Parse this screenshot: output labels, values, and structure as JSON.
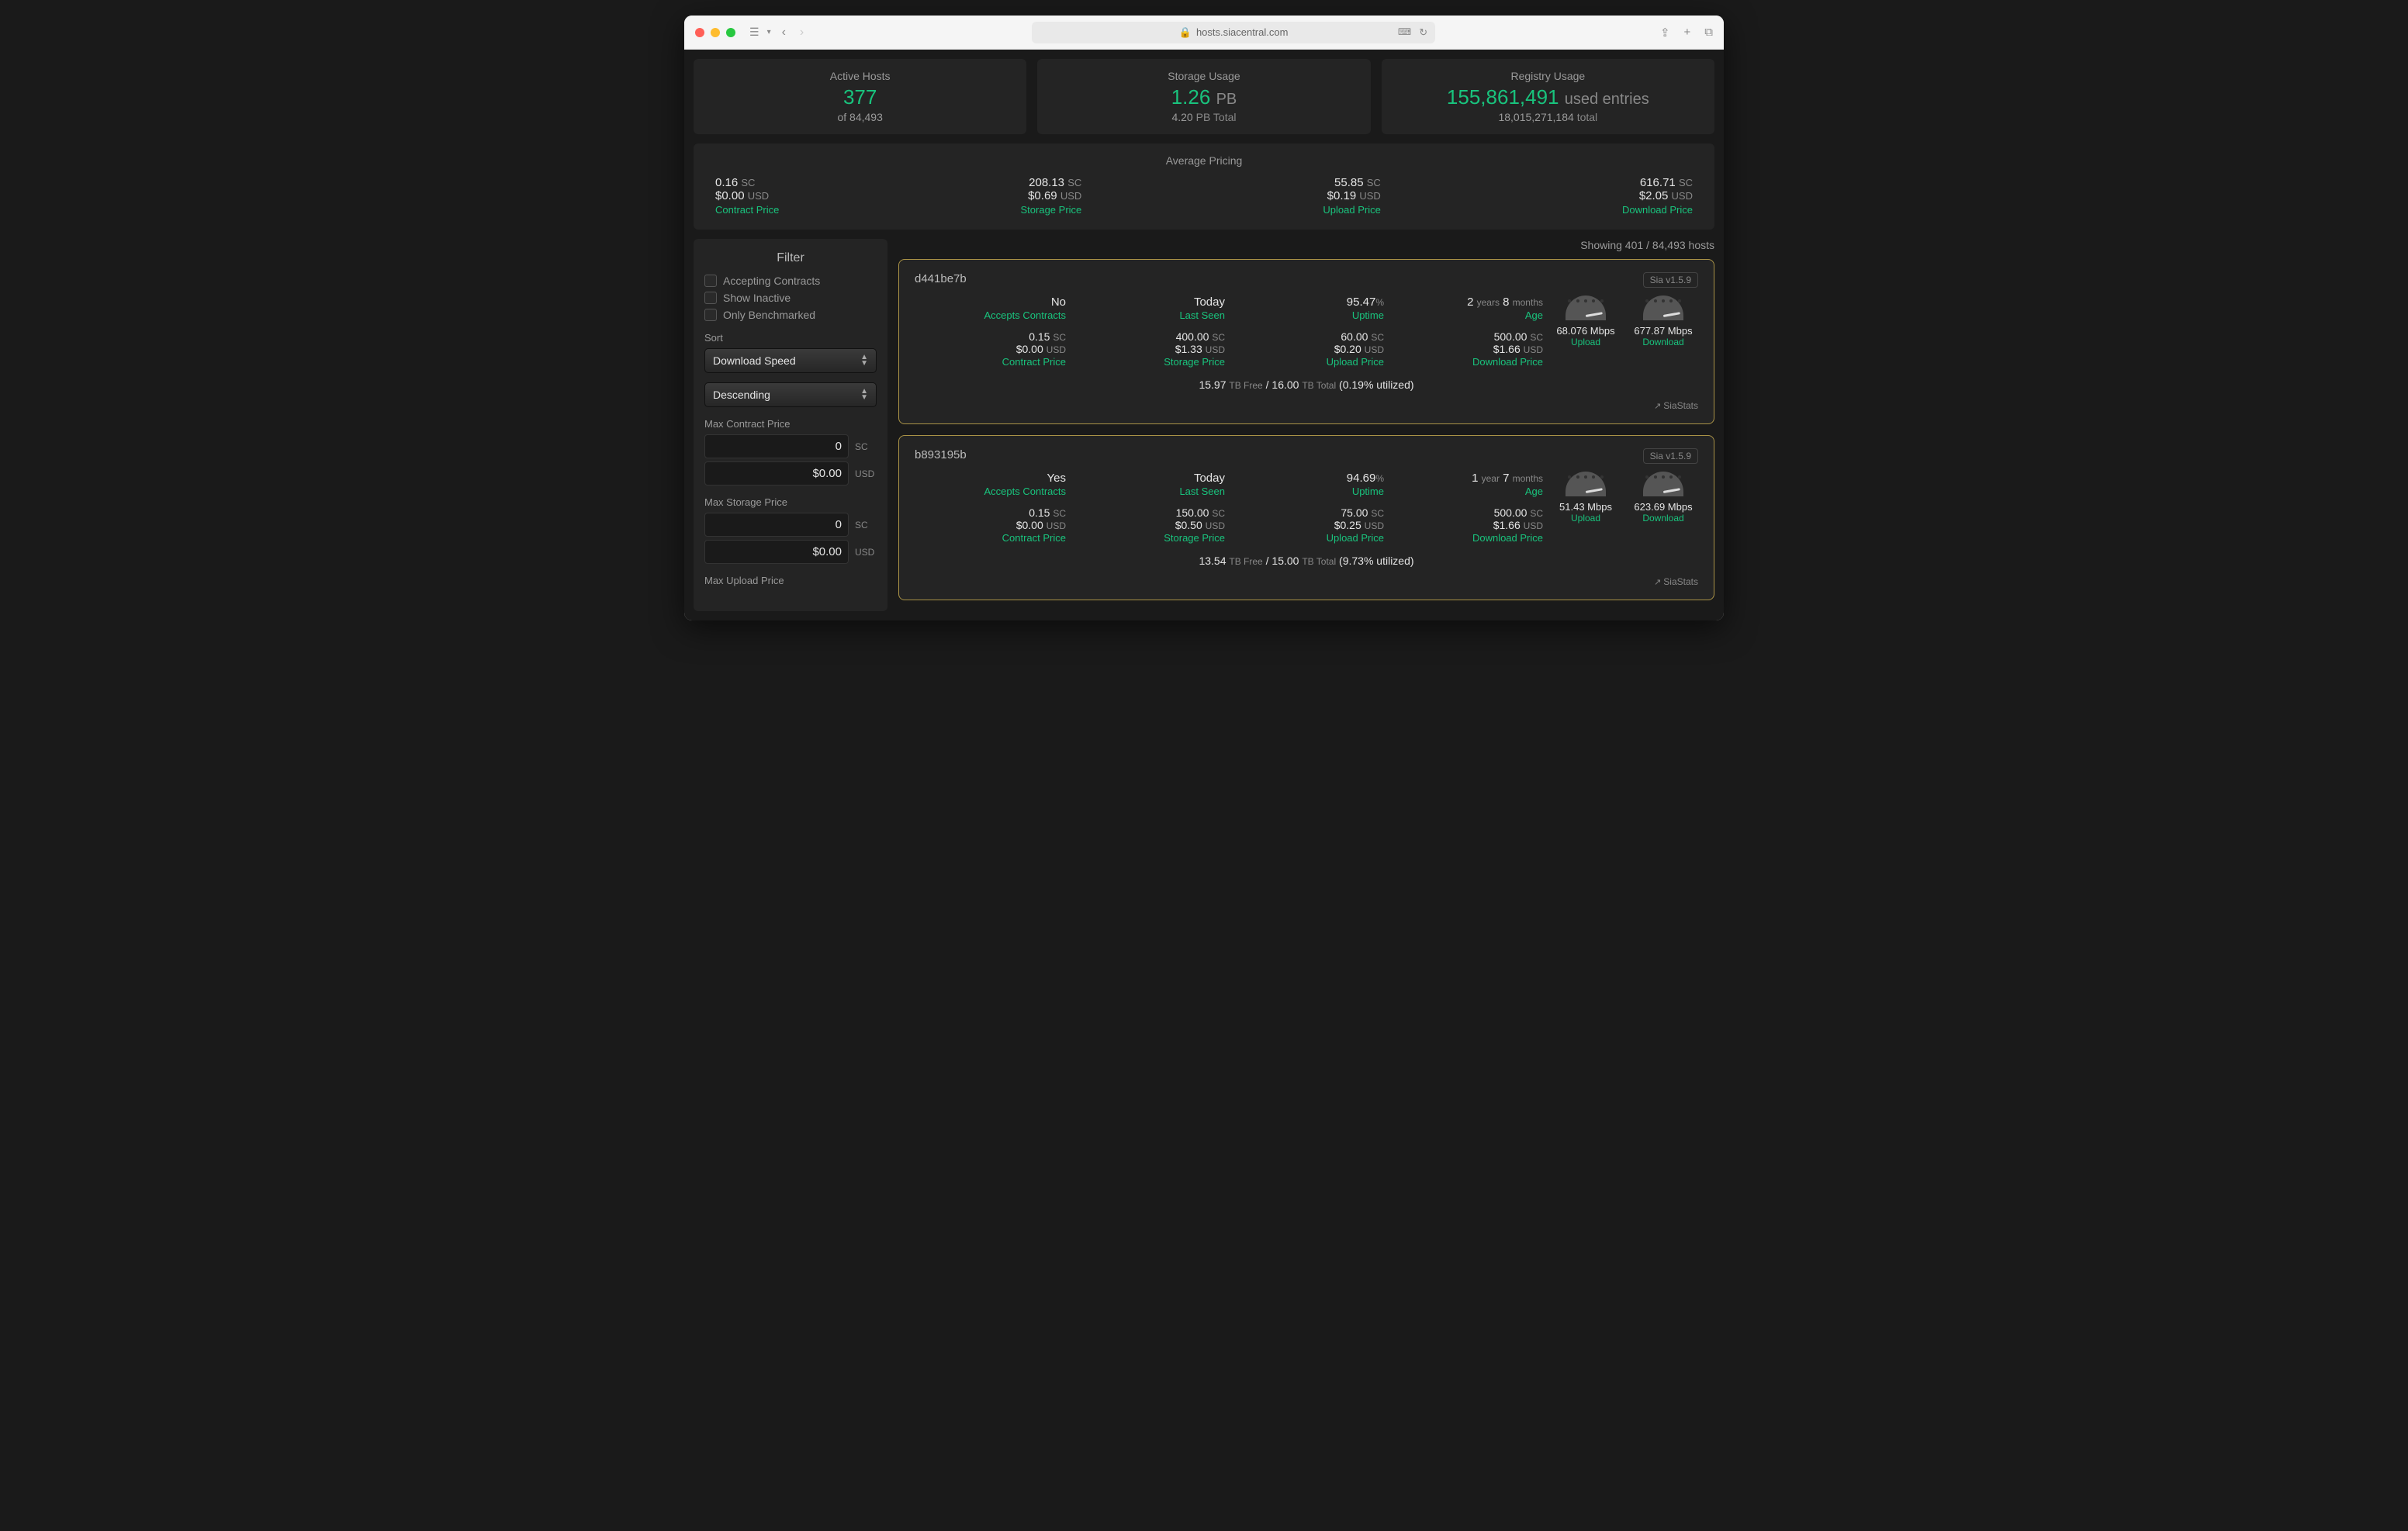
{
  "browser": {
    "url": "hosts.siacentral.com"
  },
  "stats": {
    "active_hosts": {
      "title": "Active Hosts",
      "value": "377",
      "sub_prefix": "of ",
      "sub_value": "84,493"
    },
    "storage": {
      "title": "Storage Usage",
      "value": "1.26",
      "unit": "PB",
      "sub_value": "4.20",
      "sub_unit": "PB Total"
    },
    "registry": {
      "title": "Registry Usage",
      "value": "155,861,491",
      "unit": "used entries",
      "sub_value": "18,015,271,184",
      "sub_unit": "total"
    }
  },
  "pricing": {
    "title": "Average Pricing",
    "contract": {
      "sc": "0.16",
      "usd": "$0.00",
      "label": "Contract Price"
    },
    "storage": {
      "sc": "208.13",
      "usd": "$0.69",
      "label": "Storage Price"
    },
    "upload": {
      "sc": "55.85",
      "usd": "$0.19",
      "label": "Upload Price"
    },
    "download": {
      "sc": "616.71",
      "usd": "$2.05",
      "label": "Download Price"
    }
  },
  "filter": {
    "title": "Filter",
    "accepting": "Accepting Contracts",
    "inactive": "Show Inactive",
    "benchmarked": "Only Benchmarked",
    "sort_label": "Sort",
    "sort_value": "Download Speed",
    "order_value": "Descending",
    "max_contract_label": "Max Contract Price",
    "max_storage_label": "Max Storage Price",
    "max_upload_label": "Max Upload Price",
    "zero": "0",
    "zero_usd": "$0.00",
    "sc": "SC",
    "usd": "USD"
  },
  "showing": "Showing 401 / 84,493 hosts",
  "hosts": [
    {
      "id": "d441be7b",
      "version": "Sia v1.5.9",
      "accepts": "No",
      "accepts_label": "Accepts Contracts",
      "last_seen": "Today",
      "last_seen_label": "Last Seen",
      "uptime": "95.47",
      "uptime_unit": "%",
      "uptime_label": "Uptime",
      "age_years": "2",
      "age_y_unit": "years",
      "age_months": "8",
      "age_m_unit": "months",
      "age_label": "Age",
      "contract_sc": "0.15",
      "contract_usd": "$0.00",
      "contract_label": "Contract Price",
      "storage_sc": "400.00",
      "storage_usd": "$1.33",
      "storage_label": "Storage Price",
      "upload_sc": "60.00",
      "upload_usd": "$0.20",
      "upload_label": "Upload Price",
      "download_sc": "500.00",
      "download_usd": "$1.66",
      "download_label": "Download Price",
      "up_speed": "68.076 Mbps",
      "up_label": "Upload",
      "down_speed": "677.87 Mbps",
      "down_label": "Download",
      "free": "15.97",
      "free_unit": "TB Free",
      "slash": "/",
      "total": "16.00",
      "total_unit": "TB Total",
      "util": "(0.19% utilized)",
      "siastats": "SiaStats"
    },
    {
      "id": "b893195b",
      "version": "Sia v1.5.9",
      "accepts": "Yes",
      "accepts_label": "Accepts Contracts",
      "last_seen": "Today",
      "last_seen_label": "Last Seen",
      "uptime": "94.69",
      "uptime_unit": "%",
      "uptime_label": "Uptime",
      "age_years": "1",
      "age_y_unit": "year",
      "age_months": "7",
      "age_m_unit": "months",
      "age_label": "Age",
      "contract_sc": "0.15",
      "contract_usd": "$0.00",
      "contract_label": "Contract Price",
      "storage_sc": "150.00",
      "storage_usd": "$0.50",
      "storage_label": "Storage Price",
      "upload_sc": "75.00",
      "upload_usd": "$0.25",
      "upload_label": "Upload Price",
      "download_sc": "500.00",
      "download_usd": "$1.66",
      "download_label": "Download Price",
      "up_speed": "51.43 Mbps",
      "up_label": "Upload",
      "down_speed": "623.69 Mbps",
      "down_label": "Download",
      "free": "13.54",
      "free_unit": "TB Free",
      "slash": "/",
      "total": "15.00",
      "total_unit": "TB Total",
      "util": "(9.73% utilized)",
      "siastats": "SiaStats"
    }
  ]
}
